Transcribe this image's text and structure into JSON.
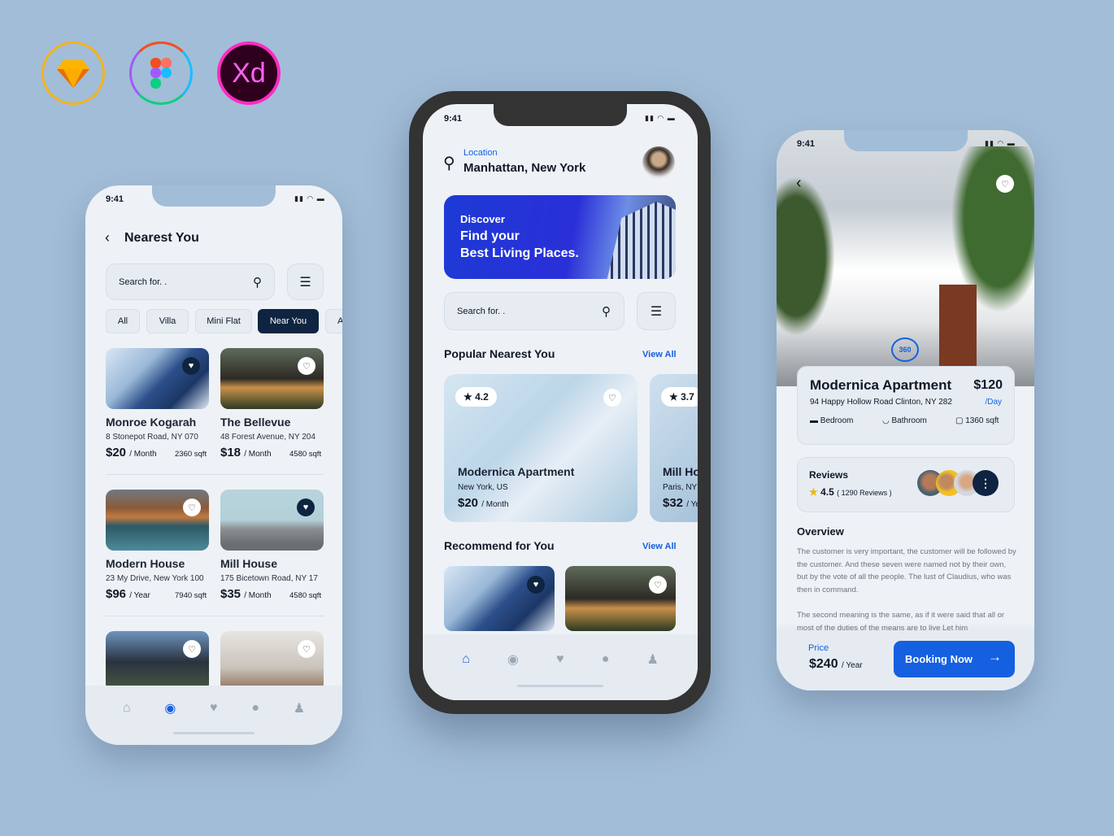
{
  "tools": {
    "sketch": "sketch-logo",
    "figma": "figma-logo",
    "xd": "Xd"
  },
  "status_time": "9:41",
  "left": {
    "title": "Nearest You",
    "search_placeholder": "Search for. .",
    "chips": [
      "All",
      "Villa",
      "Mini Flat",
      "Near You",
      "A"
    ],
    "active_chip": "Near You",
    "listings": [
      {
        "name": "Monroe Kogarah",
        "address": "8 Stonepot Road, NY 070",
        "price": "$20",
        "period": "/ Month",
        "area": "2360 sqft",
        "favorite": true
      },
      {
        "name": "The Bellevue",
        "address": "48 Forest Avenue, NY 204",
        "price": "$18",
        "period": "/ Month",
        "area": "4580 sqft",
        "favorite": false
      },
      {
        "name": "Modern House",
        "address": "23 My Drive, New York 100",
        "price": "$96",
        "period": "/ Year",
        "area": "7940 sqft",
        "favorite": false
      },
      {
        "name": "Mill House",
        "address": "175 Bicetown Road, NY 17",
        "price": "$35",
        "period": "/ Month",
        "area": "4580 sqft",
        "favorite": true
      }
    ],
    "active_nav": "explore"
  },
  "middle": {
    "location_label": "Location",
    "location": "Manhattan, New York",
    "banner": {
      "line1": "Discover",
      "line2": "Find your",
      "line3": "Best Living Places."
    },
    "search_placeholder": "Search for. .",
    "popular_title": "Popular Nearest You",
    "view_all": "View All",
    "popular": [
      {
        "rating": "4.2",
        "name": "Modernica Apartment",
        "location": "New York, US",
        "price": "$20",
        "period": "/ Month"
      },
      {
        "rating": "3.7",
        "name": "Mill House",
        "location": "Paris, NY",
        "price": "$32",
        "period": "/ Year"
      }
    ],
    "recommend_title": "Recommend for You",
    "active_nav": "home"
  },
  "right": {
    "badge": "360",
    "name": "Modernica Apartment",
    "price": "$120",
    "period": "/Day",
    "address": "94 Happy Hollow Road Clinton, NY 282",
    "features": [
      "Bedroom",
      "Bathroom",
      "1360 sqft"
    ],
    "reviews_label": "Reviews",
    "rating": "4.5",
    "reviews_count": "( 1290 Reviews )",
    "overview_title": "Overview",
    "overview_p1": "The customer is very important, the customer will be followed by the customer. And these seven were named not by their own, but by the vote of all the people. The lust of Claudius, who was then in command.",
    "overview_p2": "The second meaning is the same, as if it were said that all or most of the duties of the means are to live Let him",
    "price_label": "Price",
    "total_price": "$240",
    "total_period": "/ Year",
    "booking_button": "Booking Now"
  },
  "colors": {
    "background": "#a2bdd7",
    "accent": "#1560e0",
    "dark": "#0f2440"
  }
}
